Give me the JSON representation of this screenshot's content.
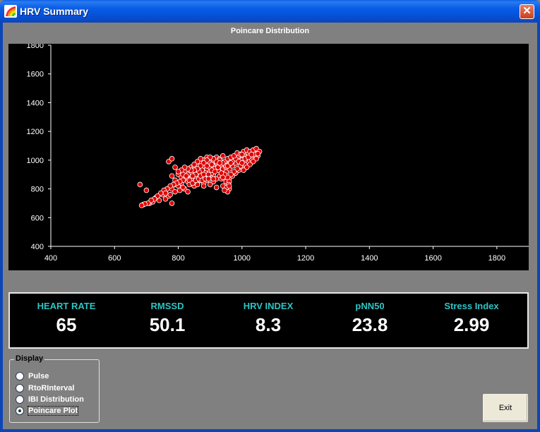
{
  "window": {
    "title": "HRV Summary",
    "close_label": "✕"
  },
  "chart_data": {
    "type": "scatter",
    "title": "Poincare Distribution",
    "xlim": [
      400,
      1900
    ],
    "ylim": [
      400,
      1800
    ],
    "x_ticks": [
      400,
      600,
      800,
      1000,
      1200,
      1400,
      1600,
      1800
    ],
    "y_ticks": [
      400,
      600,
      800,
      1000,
      1200,
      1400,
      1600,
      1800
    ],
    "point_color": "#e00000",
    "background": "#000000",
    "grid": false,
    "points": [
      [
        680,
        830
      ],
      [
        700,
        790
      ],
      [
        690,
        690
      ],
      [
        710,
        700
      ],
      [
        720,
        710
      ],
      [
        740,
        720
      ],
      [
        730,
        740
      ],
      [
        750,
        760
      ],
      [
        760,
        730
      ],
      [
        770,
        750
      ],
      [
        780,
        700
      ],
      [
        760,
        780
      ],
      [
        780,
        800
      ],
      [
        790,
        830
      ],
      [
        800,
        820
      ],
      [
        810,
        840
      ],
      [
        790,
        860
      ],
      [
        820,
        870
      ],
      [
        830,
        850
      ],
      [
        840,
        880
      ],
      [
        820,
        800
      ],
      [
        830,
        780
      ],
      [
        850,
        820
      ],
      [
        860,
        840
      ],
      [
        870,
        860
      ],
      [
        880,
        880
      ],
      [
        860,
        900
      ],
      [
        850,
        920
      ],
      [
        840,
        910
      ],
      [
        870,
        940
      ],
      [
        880,
        960
      ],
      [
        890,
        940
      ],
      [
        900,
        920
      ],
      [
        910,
        900
      ],
      [
        880,
        840
      ],
      [
        890,
        860
      ],
      [
        900,
        880
      ],
      [
        910,
        850
      ],
      [
        920,
        870
      ],
      [
        930,
        890
      ],
      [
        900,
        980
      ],
      [
        910,
        1000
      ],
      [
        920,
        960
      ],
      [
        930,
        940
      ],
      [
        940,
        960
      ],
      [
        950,
        980
      ],
      [
        960,
        1000
      ],
      [
        920,
        1020
      ],
      [
        930,
        1010
      ],
      [
        940,
        1030
      ],
      [
        950,
        920
      ],
      [
        960,
        940
      ],
      [
        970,
        960
      ],
      [
        980,
        980
      ],
      [
        990,
        1000
      ],
      [
        1000,
        1020
      ],
      [
        1010,
        1040
      ],
      [
        1020,
        1030
      ],
      [
        1030,
        1050
      ],
      [
        1040,
        1060
      ],
      [
        960,
        870
      ],
      [
        970,
        890
      ],
      [
        980,
        910
      ],
      [
        990,
        930
      ],
      [
        1000,
        950
      ],
      [
        1010,
        970
      ],
      [
        1020,
        990
      ],
      [
        1030,
        1010
      ],
      [
        1040,
        1030
      ],
      [
        1050,
        1050
      ],
      [
        940,
        820
      ],
      [
        950,
        850
      ],
      [
        960,
        800
      ],
      [
        955,
        780
      ],
      [
        920,
        810
      ],
      [
        900,
        830
      ],
      [
        880,
        820
      ],
      [
        860,
        830
      ],
      [
        850,
        850
      ],
      [
        840,
        870
      ],
      [
        770,
        990
      ],
      [
        780,
        1010
      ],
      [
        790,
        950
      ],
      [
        780,
        890
      ],
      [
        800,
        900
      ],
      [
        810,
        880
      ],
      [
        820,
        920
      ],
      [
        830,
        900
      ],
      [
        840,
        950
      ],
      [
        850,
        960
      ],
      [
        860,
        970
      ],
      [
        870,
        980
      ],
      [
        880,
        1000
      ],
      [
        890,
        1020
      ],
      [
        870,
        1010
      ],
      [
        860,
        990
      ],
      [
        850,
        970
      ],
      [
        900,
        950
      ],
      [
        910,
        960
      ],
      [
        920,
        980
      ],
      [
        930,
        960
      ],
      [
        940,
        940
      ],
      [
        950,
        950
      ],
      [
        960,
        970
      ],
      [
        970,
        990
      ],
      [
        980,
        1010
      ],
      [
        990,
        1030
      ],
      [
        1000,
        1000
      ],
      [
        1010,
        1020
      ],
      [
        1020,
        1050
      ],
      [
        1030,
        1030
      ],
      [
        1040,
        1040
      ],
      [
        1050,
        1030
      ],
      [
        1045,
        1010
      ],
      [
        1035,
        990
      ],
      [
        1025,
        970
      ],
      [
        1015,
        950
      ],
      [
        1005,
        930
      ],
      [
        995,
        960
      ],
      [
        985,
        940
      ],
      [
        975,
        920
      ],
      [
        965,
        900
      ],
      [
        955,
        880
      ],
      [
        945,
        900
      ],
      [
        935,
        910
      ],
      [
        925,
        930
      ],
      [
        915,
        940
      ],
      [
        905,
        910
      ],
      [
        895,
        890
      ],
      [
        885,
        910
      ],
      [
        875,
        930
      ],
      [
        865,
        920
      ],
      [
        855,
        900
      ],
      [
        845,
        890
      ],
      [
        835,
        860
      ],
      [
        825,
        880
      ],
      [
        815,
        860
      ],
      [
        805,
        850
      ],
      [
        795,
        840
      ],
      [
        785,
        830
      ],
      [
        775,
        820
      ],
      [
        765,
        800
      ],
      [
        755,
        790
      ],
      [
        745,
        770
      ],
      [
        735,
        750
      ],
      [
        725,
        730
      ],
      [
        715,
        720
      ],
      [
        705,
        700
      ],
      [
        695,
        695
      ],
      [
        685,
        685
      ],
      [
        760,
        770
      ],
      [
        775,
        760
      ],
      [
        790,
        780
      ],
      [
        805,
        790
      ],
      [
        815,
        810
      ],
      [
        835,
        830
      ],
      [
        845,
        840
      ],
      [
        855,
        860
      ],
      [
        865,
        870
      ],
      [
        875,
        860
      ],
      [
        885,
        870
      ],
      [
        895,
        900
      ],
      [
        905,
        930
      ],
      [
        915,
        920
      ],
      [
        925,
        950
      ],
      [
        935,
        970
      ],
      [
        945,
        990
      ],
      [
        955,
        1010
      ],
      [
        965,
        1020
      ],
      [
        975,
        1030
      ],
      [
        985,
        1050
      ],
      [
        995,
        1040
      ],
      [
        1005,
        1060
      ],
      [
        1015,
        1070
      ],
      [
        1025,
        1060
      ],
      [
        1035,
        1070
      ],
      [
        1045,
        1080
      ],
      [
        1055,
        1060
      ],
      [
        1050,
        1045
      ],
      [
        1010,
        1000
      ],
      [
        950,
        960
      ],
      [
        940,
        980
      ],
      [
        930,
        1000
      ],
      [
        920,
        990
      ],
      [
        910,
        1010
      ],
      [
        900,
        1020
      ],
      [
        890,
        1000
      ],
      [
        880,
        980
      ],
      [
        870,
        960
      ],
      [
        860,
        940
      ],
      [
        850,
        930
      ],
      [
        840,
        930
      ],
      [
        830,
        940
      ],
      [
        820,
        950
      ],
      [
        810,
        930
      ],
      [
        800,
        920
      ],
      [
        815,
        900
      ],
      [
        825,
        890
      ],
      [
        870,
        890
      ],
      [
        890,
        960
      ],
      [
        905,
        970
      ],
      [
        930,
        980
      ],
      [
        955,
        960
      ],
      [
        965,
        980
      ],
      [
        990,
        990
      ],
      [
        1000,
        980
      ],
      [
        1010,
        1010
      ],
      [
        1020,
        1020
      ],
      [
        1030,
        1040
      ],
      [
        1000,
        1040
      ],
      [
        960,
        850
      ],
      [
        958,
        830
      ],
      [
        952,
        810
      ],
      [
        945,
        790
      ],
      [
        960,
        820
      ],
      [
        935,
        870
      ],
      [
        940,
        880
      ],
      [
        910,
        870
      ],
      [
        895,
        870
      ],
      [
        880,
        900
      ]
    ]
  },
  "stats": [
    {
      "label": "HEART RATE",
      "value": "65"
    },
    {
      "label": "RMSSD",
      "value": "50.1"
    },
    {
      "label": "HRV INDEX",
      "value": "8.3"
    },
    {
      "label": "pNN50",
      "value": "23.8"
    },
    {
      "label": "Stress Index",
      "value": "2.99"
    }
  ],
  "display_group": {
    "legend": "Display",
    "options": [
      {
        "label": "Pulse",
        "checked": false
      },
      {
        "label": "RtoRInterval",
        "checked": false
      },
      {
        "label": "IBI Distribution",
        "checked": false
      },
      {
        "label": "Poincare Plot",
        "checked": true
      }
    ]
  },
  "exit_label": "Exit"
}
